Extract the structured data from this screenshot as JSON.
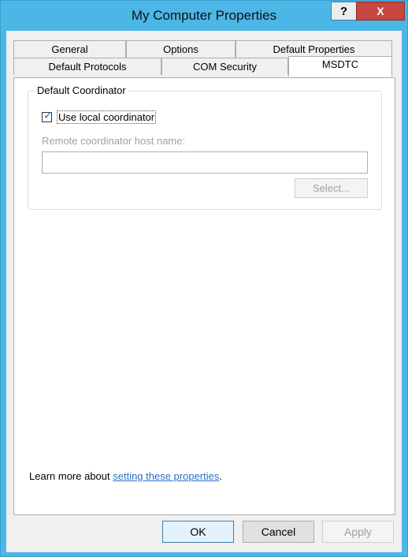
{
  "window": {
    "title": "My Computer Properties",
    "help_symbol": "?",
    "close_symbol": "X"
  },
  "tabs": {
    "row1": [
      "General",
      "Options",
      "Default Properties"
    ],
    "row2": [
      "Default Protocols",
      "COM Security",
      "MSDTC"
    ],
    "active": "MSDTC"
  },
  "group": {
    "label": "Default Coordinator",
    "checkbox_label": "Use local coordinator",
    "checkbox_checked": true,
    "remote_label": "Remote coordinator host name:",
    "remote_value": "",
    "select_label": "Select..."
  },
  "learn_more": {
    "prefix": "Learn more about ",
    "link": "setting these properties",
    "suffix": "."
  },
  "buttons": {
    "ok": "OK",
    "cancel": "Cancel",
    "apply": "Apply"
  },
  "colors": {
    "frame": "#4cb6e6",
    "close": "#c7463e",
    "link": "#2b6fc7",
    "check": "#1a74c8"
  }
}
